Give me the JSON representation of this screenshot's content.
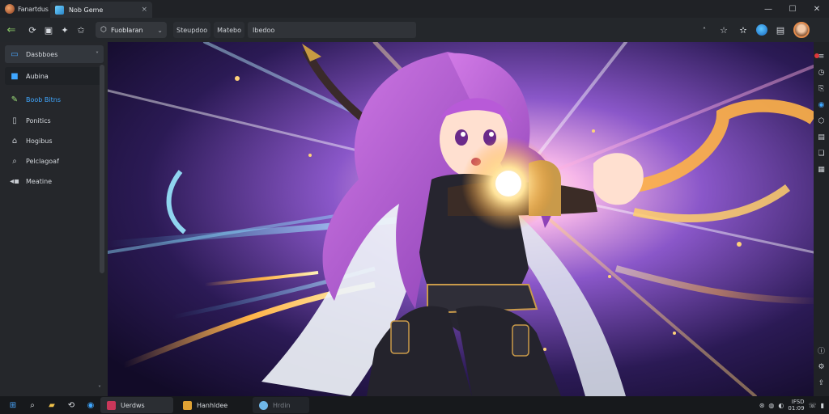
{
  "app": {
    "name": "Fanartdus",
    "logo_icon": "app-logo-icon"
  },
  "tab": {
    "label": "Nob Geme",
    "icon": "image-tab-icon",
    "close_glyph": "×"
  },
  "window_controls": {
    "minimize": "—",
    "maximize": "☐",
    "close": "✕"
  },
  "toolbar": {
    "back_glyph": "⇐",
    "selector_label": "Fuoblaran",
    "breadcrumbs": [
      "Steupdoo",
      "Matebo"
    ],
    "url": "Ibedoo",
    "right_caret": "˄"
  },
  "sidebar": {
    "items": [
      {
        "label": "Dasbboes",
        "icon": "monitor-icon",
        "glyph": "▭",
        "state": "active",
        "has_chevron": true
      },
      {
        "label": "Aubina",
        "icon": "cube-icon",
        "glyph": "■",
        "state": "selected-dark"
      },
      {
        "label": "Boob Bitns",
        "icon": "brush-icon",
        "glyph": "✎",
        "state": "highlight"
      },
      {
        "label": "Ponitics",
        "icon": "document-icon",
        "glyph": "▯",
        "state": ""
      },
      {
        "label": "Hogibus",
        "icon": "tag-icon",
        "glyph": "⌂",
        "state": ""
      },
      {
        "label": "Pelclagoaf",
        "icon": "search-icon",
        "glyph": "⌕",
        "state": ""
      },
      {
        "label": "Meatine",
        "icon": "box-icon",
        "glyph": "▪",
        "state": "",
        "has_left_caret": true
      }
    ],
    "chevron_glyph": "˅",
    "left_caret_glyph": "◂"
  },
  "rightrail": {
    "icons": [
      "menu-icon",
      "history-icon",
      "copy-icon",
      "edge-icon",
      "shield-icon",
      "note-icon",
      "layers-icon",
      "grid-icon",
      "info-icon",
      "settings-icon",
      "share-icon"
    ]
  },
  "taskbar": {
    "apps": [
      {
        "label": "Uerdws",
        "icon": "gallery-app-icon",
        "color": "#c9375a",
        "active": true
      },
      {
        "label": "Hanhldee",
        "icon": "paint-app-icon",
        "color": "#e0a234",
        "active": false
      },
      {
        "label": "Hrdin",
        "icon": "browser-app-icon",
        "color": "#6fb7e8",
        "active": false
      }
    ],
    "clock_top": "IFSD",
    "clock_bottom": "01:09"
  },
  "colors": {
    "accent": "#3fa7ff",
    "bg": "#1b1d21",
    "hair": "#c86ad6",
    "energy": "#ffb347"
  }
}
